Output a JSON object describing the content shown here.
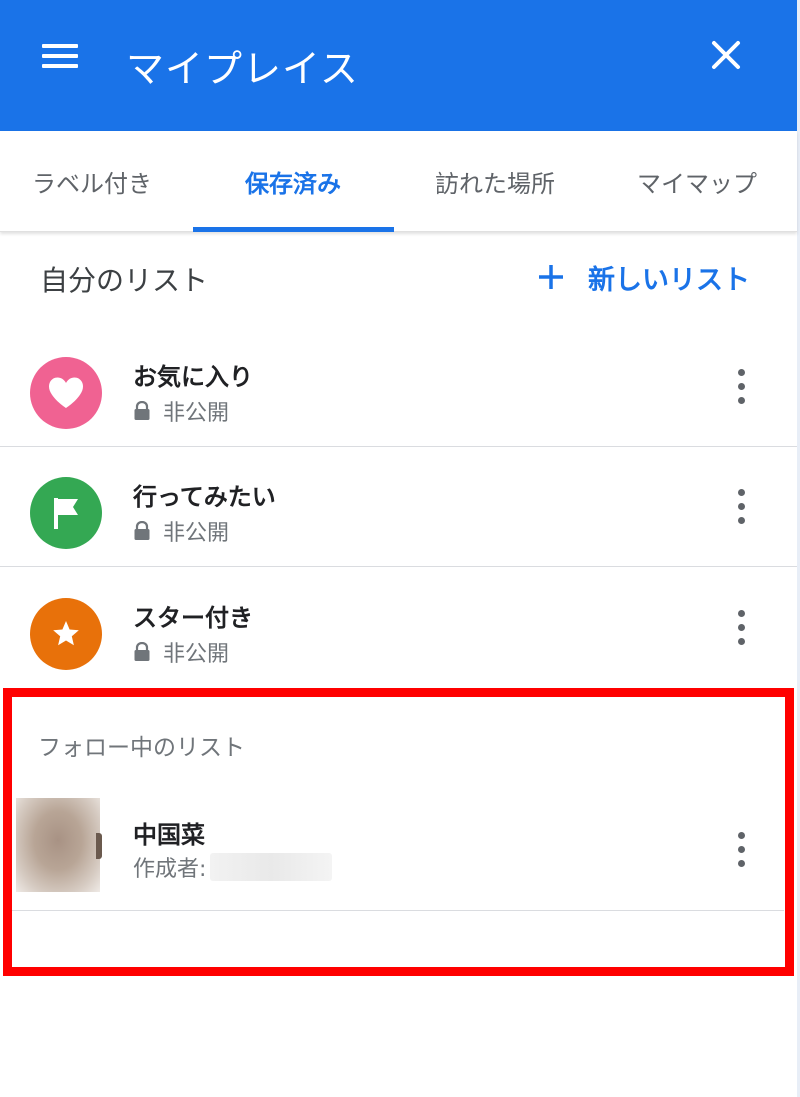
{
  "header": {
    "title": "マイプレイス",
    "menu_icon": "menu-icon",
    "close_icon": "close-icon",
    "bg_color": "#1a73e8"
  },
  "tabs": [
    {
      "label": "ラベル付き",
      "active": false
    },
    {
      "label": "保存済み",
      "active": true
    },
    {
      "label": "訪れた場所",
      "active": false
    },
    {
      "label": "マイマップ",
      "active": false
    }
  ],
  "my_lists": {
    "title": "自分のリスト",
    "new_list_label": "新しいリスト",
    "items": [
      {
        "title": "お気に入り",
        "subtitle": "非公開",
        "icon": "heart-icon",
        "color": "#f06292"
      },
      {
        "title": "行ってみたい",
        "subtitle": "非公開",
        "icon": "flag-icon",
        "color": "#34a853"
      },
      {
        "title": "スター付き",
        "subtitle": "非公開",
        "icon": "star-icon",
        "color": "#e8710a"
      }
    ]
  },
  "followed_lists": {
    "title": "フォロー中のリスト",
    "items": [
      {
        "title": "中国菜",
        "subtitle": "作成者:"
      }
    ]
  },
  "highlight_color": "#ff0000"
}
